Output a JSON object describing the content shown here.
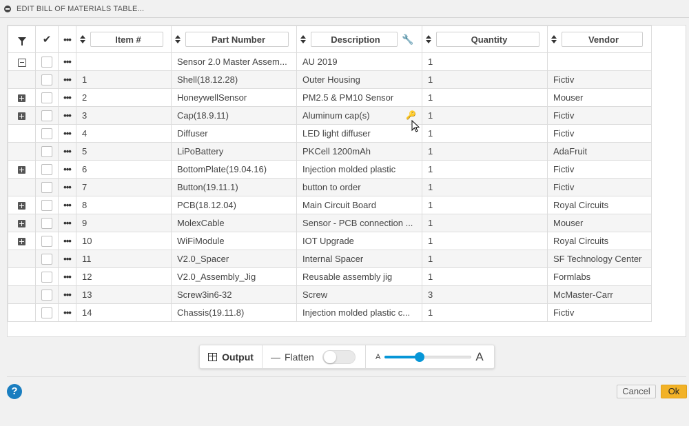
{
  "dialog": {
    "title": "EDIT BILL OF MATERIALS TABLE..."
  },
  "columns": [
    "Item #",
    "Part Number",
    "Description",
    "Quantity",
    "Vendor"
  ],
  "rows": [
    {
      "expander": "collapse",
      "item": "",
      "part": "Sensor 2.0 Master Assem...",
      "description": "AU 2019",
      "quantity": "1",
      "vendor": ""
    },
    {
      "expander": "",
      "item": "1",
      "part": "Shell(18.12.28)",
      "description": "Outer Housing",
      "quantity": "1",
      "vendor": "Fictiv"
    },
    {
      "expander": "expand",
      "item": "2",
      "part": "HoneywellSensor",
      "description": "PM2.5 & PM10 Sensor",
      "quantity": "1",
      "vendor": "Mouser"
    },
    {
      "expander": "expand",
      "item": "3",
      "part": "Cap(18.9.11)",
      "description": "Aluminum cap(s)",
      "quantity": "1",
      "vendor": "Fictiv",
      "key": true
    },
    {
      "expander": "",
      "item": "4",
      "part": "Diffuser",
      "description": "LED light diffuser",
      "quantity": "1",
      "vendor": "Fictiv"
    },
    {
      "expander": "",
      "item": "5",
      "part": "LiPoBattery",
      "description": "PKCell 1200mAh",
      "quantity": "1",
      "vendor": "AdaFruit"
    },
    {
      "expander": "expand",
      "item": "6",
      "part": "BottomPlate(19.04.16)",
      "description": "Injection molded plastic",
      "quantity": "1",
      "vendor": "Fictiv"
    },
    {
      "expander": "",
      "item": "7",
      "part": "Button(19.11.1)",
      "description": "button to order",
      "quantity": "1",
      "vendor": "Fictiv"
    },
    {
      "expander": "expand",
      "item": "8",
      "part": "PCB(18.12.04)",
      "description": "Main Circuit Board",
      "quantity": "1",
      "vendor": "Royal Circuits"
    },
    {
      "expander": "expand",
      "item": "9",
      "part": "MolexCable",
      "description": "Sensor - PCB connection ...",
      "quantity": "1",
      "vendor": "Mouser"
    },
    {
      "expander": "expand",
      "item": "10",
      "part": "WiFiModule",
      "description": "IOT Upgrade",
      "quantity": "1",
      "vendor": "Royal Circuits"
    },
    {
      "expander": "",
      "item": "11",
      "part": "V2.0_Spacer",
      "description": "Internal Spacer",
      "quantity": "1",
      "vendor": "SF Technology Center"
    },
    {
      "expander": "",
      "item": "12",
      "part": "V2.0_Assembly_Jig",
      "description": "Reusable assembly jig",
      "quantity": "1",
      "vendor": "Formlabs"
    },
    {
      "expander": "",
      "item": "13",
      "part": "Screw3in6-32",
      "description": "Screw",
      "quantity": "3",
      "vendor": "McMaster-Carr"
    },
    {
      "expander": "",
      "item": "14",
      "part": "Chassis(19.11.8)",
      "description": "Injection molded plastic c...",
      "quantity": "1",
      "vendor": "Fictiv"
    }
  ],
  "toolbar": {
    "output_label": "Output",
    "flatten_label": "Flatten",
    "flatten_on": false,
    "font_small_label": "A",
    "font_large_label": "A",
    "font_size_level": 0.4
  },
  "footer": {
    "help_label": "?",
    "cancel_label": "Cancel",
    "ok_label": "Ok"
  },
  "colors": {
    "accent": "#0696d7",
    "ok": "#f2b227",
    "help": "#1a7ec0"
  },
  "icons": [
    "filter-icon",
    "check-icon",
    "more-icon",
    "sort-icon",
    "wrench-icon",
    "key-icon",
    "expand-icon",
    "collapse-icon",
    "table-icon",
    "help-icon"
  ]
}
